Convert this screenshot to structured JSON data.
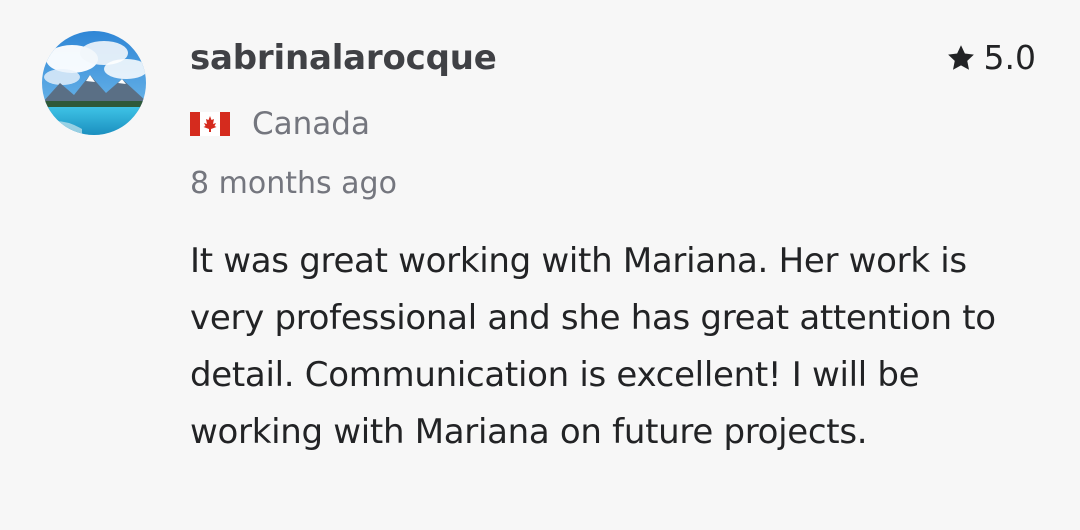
{
  "review": {
    "username": "sabrinalarocque",
    "rating": "5.0",
    "country": "Canada",
    "time_ago": "8 months ago",
    "text": "It was great working with Mariana. Her work is very professional and she has great attention to detail. Communication is excellent! I will be working with Mariana on future projects."
  },
  "icons": {
    "star": "star-icon",
    "flag": "canada-flag-icon",
    "avatar": "mountain-lake-photo"
  },
  "colors": {
    "background": "#f7f7f7",
    "username": "#404145",
    "text": "#222325",
    "muted": "#74767e",
    "flag_red": "#d52b1e"
  }
}
